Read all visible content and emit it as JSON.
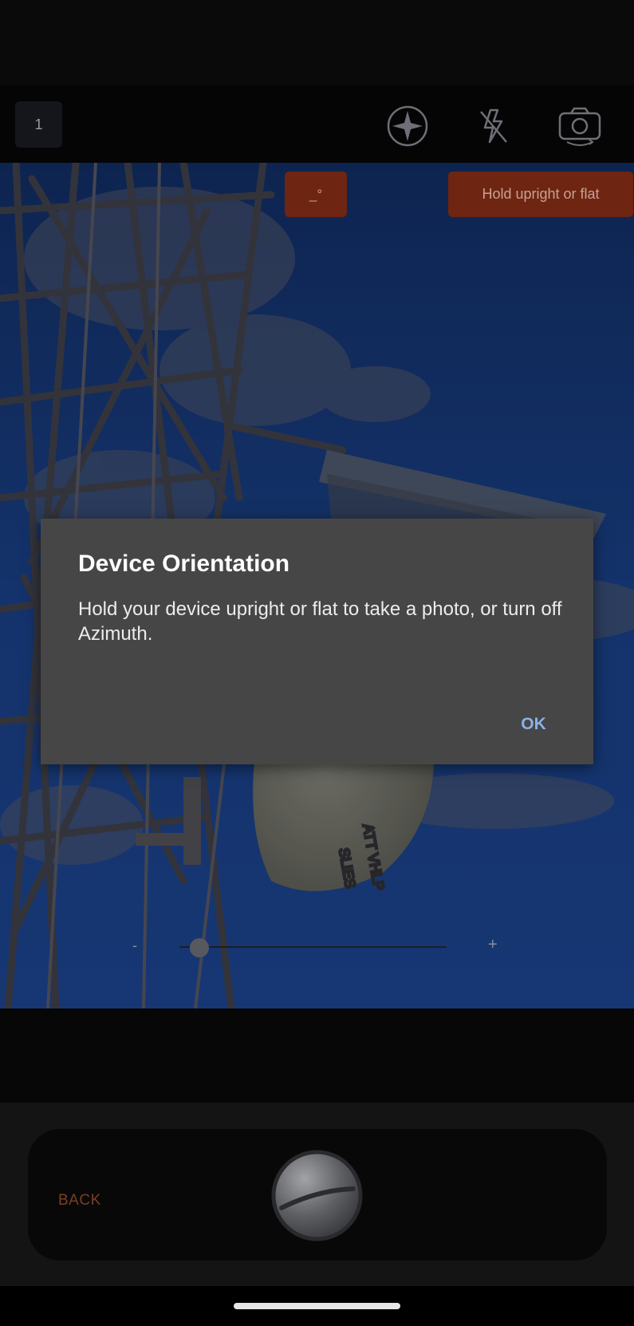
{
  "toolbar": {
    "photo_count": "1",
    "icons": [
      "compass-icon",
      "flash-off-icon",
      "camera-switch-icon"
    ]
  },
  "overlay": {
    "angle_readout": "_°",
    "orientation_hint": "Hold upright or flat"
  },
  "zoom": {
    "minus_label": "-",
    "plus_label": "+",
    "level": 0.15
  },
  "controls": {
    "back_label": "BACK"
  },
  "dialog": {
    "title": "Device Orientation",
    "message": "Hold your device upright or flat to take a photo, or turn off Azimuth.",
    "ok_label": "OK"
  },
  "colors": {
    "badge_bg": "#6e2512",
    "back_text": "#7b3f22",
    "dialog_bg": "#464646",
    "dialog_button": "#8ab1e6"
  }
}
